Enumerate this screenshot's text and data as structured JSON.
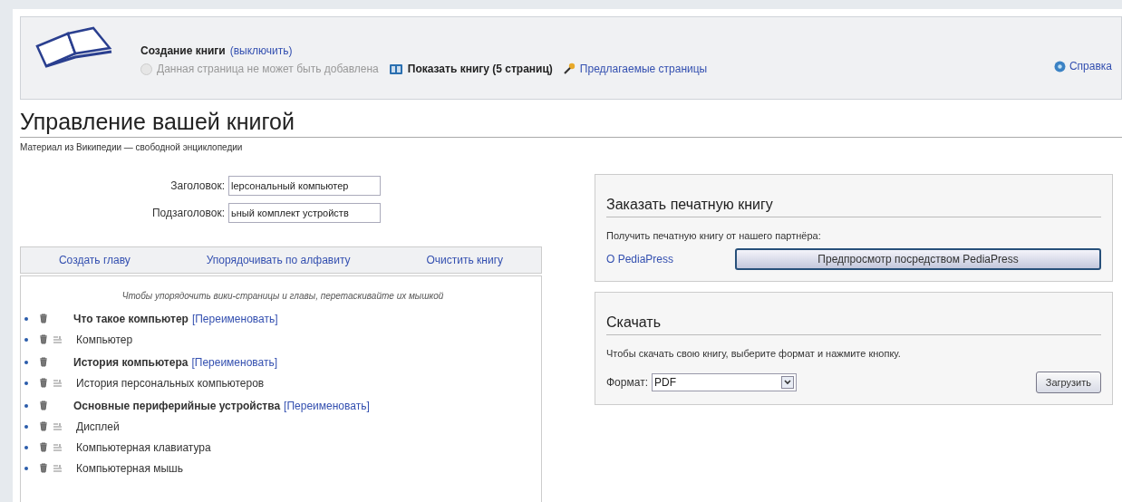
{
  "book_bar": {
    "title": "Создание книги",
    "disable_link": "(выключить)",
    "add_status": "Данная страница не может быть добавлена",
    "show_book": "Показать книгу (5 страниц)",
    "suggested": "Предлагаемые страницы",
    "help": "Справка"
  },
  "page": {
    "title": "Управление вашей книгой",
    "subtitle": "Материал из Википедии — свободной энциклопедии"
  },
  "fields": [
    {
      "label": "Заголовок:",
      "value": "lерсональный компьютер"
    },
    {
      "label": "Подзаголовок:",
      "value": "ьный комплект устройств"
    }
  ],
  "toolbar": [
    "Создать главу",
    "Упорядочивать по алфавиту",
    "Очистить книгу"
  ],
  "hint": "Чтобы упорядочить вики-страницы и главы, перетаскивайте их мышкой",
  "chapters": [
    {
      "title": "Что такое компьютер",
      "rename": "[Переименовать]",
      "children": [
        {
          "title": "Компьютер"
        }
      ]
    },
    {
      "title": "История компьютера",
      "rename": "[Переименовать]",
      "children": [
        {
          "title": "История персональных компьютеров"
        }
      ]
    },
    {
      "title": "Основные периферийные устройства",
      "rename": "[Переименовать]",
      "children": [
        {
          "title": "Дисплей"
        },
        {
          "title": "Компьютерная клавиатура"
        },
        {
          "title": "Компьютерная мышь"
        }
      ]
    }
  ],
  "print_panel": {
    "heading": "Заказать печатную книгу",
    "text": "Получить печатную книгу от нашего партнёра:",
    "about_link": "О PediaPress",
    "preview_button": "Предпросмотр посредством PediaPress"
  },
  "download_panel": {
    "heading": "Скачать",
    "text": "Чтобы скачать свою книгу, выберите формат и нажмите кнопку.",
    "format_label": "Формат:",
    "format_value": "PDF",
    "download_button": "Загрузить"
  }
}
